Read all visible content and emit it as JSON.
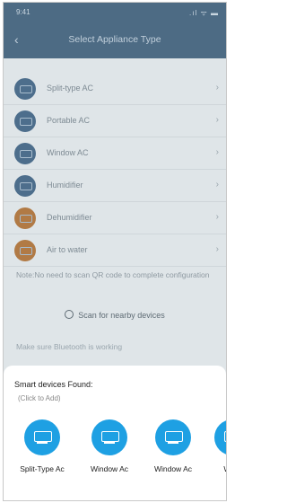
{
  "status": {
    "time": "9:41",
    "icons": ".ıl ᯤ ▬"
  },
  "header": {
    "back_icon": "‹",
    "title": "Select Appliance Type"
  },
  "appliances": [
    {
      "label": "Split-type AC",
      "icon": "split-ac-icon",
      "color": "#4d6e8c"
    },
    {
      "label": "Portable AC",
      "icon": "portable-ac-icon",
      "color": "#4d6e8c"
    },
    {
      "label": "Window AC",
      "icon": "window-ac-icon",
      "color": "#4d6e8c"
    },
    {
      "label": "Humidifier",
      "icon": "humidifier-icon",
      "color": "#4d6e8c"
    },
    {
      "label": "Dehumidifier",
      "icon": "dehumidifier-icon",
      "color": "#b17a45"
    },
    {
      "label": "Air to water",
      "icon": "air-to-water-icon",
      "color": "#b17a45"
    }
  ],
  "note": "Note:No need to scan QR code to complete configuration",
  "scan_button": "Scan for nearby devices",
  "bluetooth_note": "Make sure Bluetooth is working",
  "sheet": {
    "heading": "Smart devices Found:",
    "subheading": "(Click to Add)",
    "devices": [
      {
        "name": "Split-Type Ac"
      },
      {
        "name": "Window Ac"
      },
      {
        "name": "Window Ac"
      },
      {
        "name": "Wind"
      }
    ]
  },
  "colors": {
    "accent": "#1ea0e3",
    "header": "#4d6b84"
  }
}
